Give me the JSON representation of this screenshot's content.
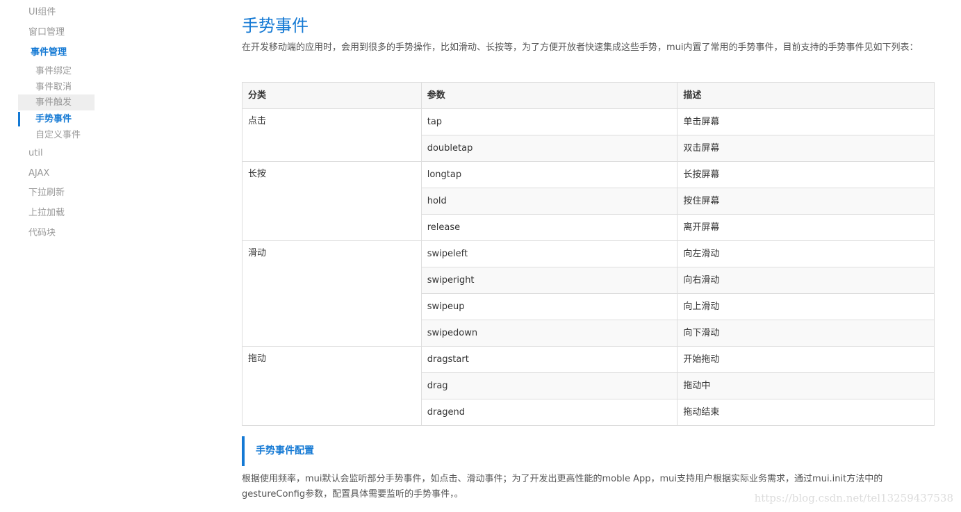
{
  "sidebar": {
    "items_before": [
      {
        "label": "UI组件"
      },
      {
        "label": "窗口管理"
      }
    ],
    "active_group": {
      "label": "事件管理",
      "children": [
        {
          "label": "事件绑定"
        },
        {
          "label": "事件取消"
        },
        {
          "label": "事件触发"
        },
        {
          "label": "手势事件"
        },
        {
          "label": "自定义事件"
        }
      ]
    },
    "items_after": [
      {
        "label": "util"
      },
      {
        "label": "AJAX"
      },
      {
        "label": "下拉刷新"
      },
      {
        "label": "上拉加载"
      },
      {
        "label": "代码块"
      }
    ]
  },
  "main": {
    "title": "手势事件",
    "intro": "在开发移动端的应用时，会用到很多的手势操作，比如滑动、长按等，为了方便开放者快速集成这些手势，mui内置了常用的手势事件，目前支持的手势事件见如下列表：",
    "table": {
      "headers": [
        "分类",
        "参数",
        "描述"
      ],
      "groups": [
        {
          "category": "点击",
          "rows": [
            {
              "param": "tap",
              "desc": "单击屏幕"
            },
            {
              "param": "doubletap",
              "desc": "双击屏幕"
            }
          ]
        },
        {
          "category": "长按",
          "rows": [
            {
              "param": "longtap",
              "desc": "长按屏幕"
            },
            {
              "param": "hold",
              "desc": "按住屏幕"
            },
            {
              "param": "release",
              "desc": "离开屏幕"
            }
          ]
        },
        {
          "category": "滑动",
          "rows": [
            {
              "param": "swipeleft",
              "desc": "向左滑动"
            },
            {
              "param": "swiperight",
              "desc": "向右滑动"
            },
            {
              "param": "swipeup",
              "desc": "向上滑动"
            },
            {
              "param": "swipedown",
              "desc": "向下滑动"
            }
          ]
        },
        {
          "category": "拖动",
          "rows": [
            {
              "param": "dragstart",
              "desc": "开始拖动"
            },
            {
              "param": "drag",
              "desc": "拖动中"
            },
            {
              "param": "dragend",
              "desc": "拖动结束"
            }
          ]
        }
      ]
    },
    "section_heading": "手势事件配置",
    "config_text": "根据使用频率，mui默认会监听部分手势事件，如点击、滑动事件；为了开发出更高性能的moble App，mui支持用户根据实际业务需求，通过mui.init方法中的gestureConfig参数，配置具体需要监听的手势事件，。"
  },
  "watermark": "https://blog.csdn.net/tel13259437538",
  "colors": {
    "accent": "#1479d4",
    "muted_text": "#999999",
    "border": "#dddddd",
    "hover_bg": "#eeeeee"
  }
}
